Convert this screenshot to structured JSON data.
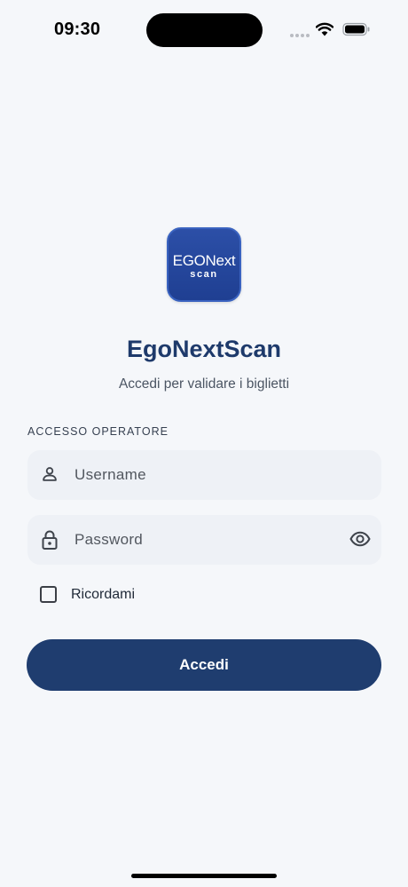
{
  "status_bar": {
    "time": "09:30"
  },
  "app": {
    "logo_text_line1": "EGONext",
    "logo_text_line2": "scan",
    "title": "EgoNextScan",
    "subtitle": "Accedi per validare i biglietti"
  },
  "form": {
    "section_label": "ACCESSO OPERATORE",
    "username": {
      "placeholder": "Username",
      "value": "",
      "icon": "user-icon"
    },
    "password": {
      "placeholder": "Password",
      "value": "",
      "icon": "lock-icon",
      "toggle_icon": "eye-icon"
    },
    "remember": {
      "label": "Ricordami",
      "checked": false
    },
    "submit_label": "Accedi"
  },
  "colors": {
    "background": "#f5f7fa",
    "primary": "#1f3d6f",
    "title": "#1e3a6b",
    "field_background": "#eef1f6",
    "logo_blue": "#2446a0"
  }
}
